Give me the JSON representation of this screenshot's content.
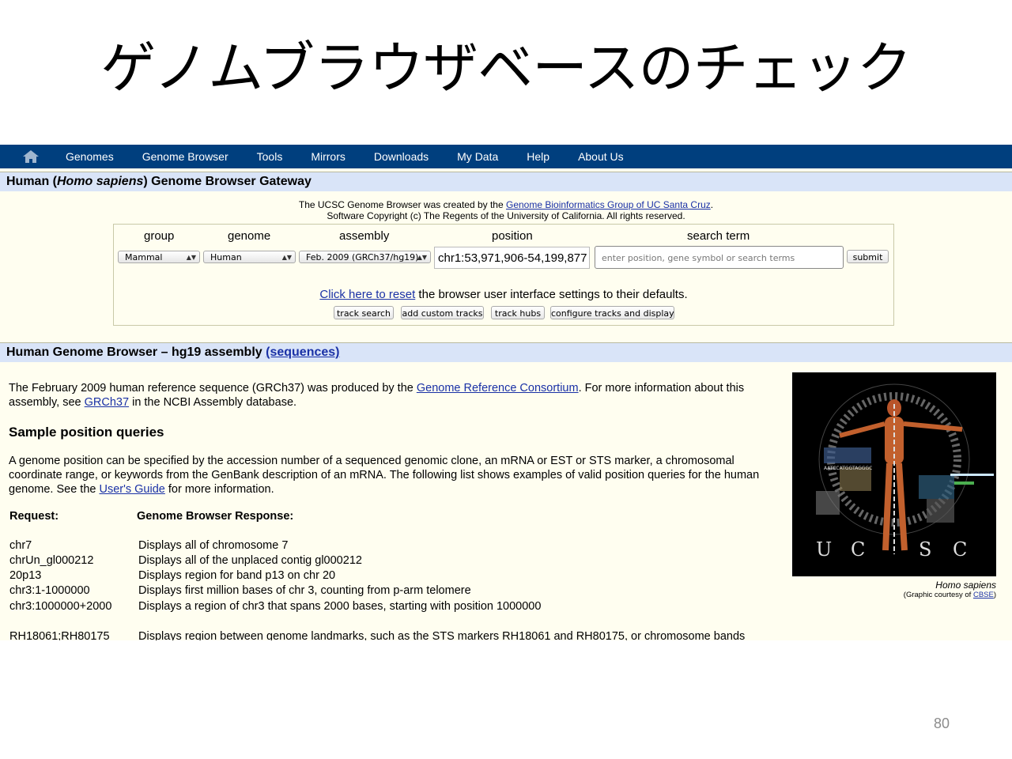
{
  "slide": {
    "title": "ゲノムブラウザベースのチェック",
    "page_number": "80"
  },
  "nav": {
    "home_icon": "home-icon",
    "items": [
      "Genomes",
      "Genome Browser",
      "Tools",
      "Mirrors",
      "Downloads",
      "My Data",
      "Help",
      "About Us"
    ]
  },
  "gateway": {
    "title_prefix": "Human (",
    "title_species": "Homo sapiens",
    "title_suffix": ") Genome Browser Gateway",
    "credit_text1": "The UCSC Genome Browser was created by the ",
    "credit_link": "Genome Bioinformatics Group of UC Santa Cruz",
    "credit_text1_end": ".",
    "credit_text2": "Software Copyright (c) The Regents of the University of California. All rights reserved.",
    "labels": {
      "group": "group",
      "genome": "genome",
      "assembly": "assembly",
      "position": "position",
      "search_term": "search term"
    },
    "group_value": "Mammal",
    "genome_value": "Human",
    "assembly_value": "Feb. 2009 (GRCh37/hg19)",
    "position_value": "chr1:53,971,906-54,199,877",
    "search_placeholder": "enter position, gene symbol or search terms",
    "submit_label": "submit",
    "reset_link": "Click here to reset",
    "reset_text": " the browser user interface settings to their defaults.",
    "buttons": {
      "track_search": "track search",
      "add_custom_tracks": "add custom tracks",
      "track_hubs": "track hubs",
      "configure": "configure tracks and display"
    }
  },
  "browser": {
    "title": "Human Genome Browser – hg19 assembly ",
    "sequences_link": "(sequences)",
    "intro_1": "The February 2009 human reference sequence (GRCh37) was produced by the ",
    "intro_link1": "Genome Reference Consortium",
    "intro_2": ". For more information about this assembly, see ",
    "intro_link2": "GRCh37",
    "intro_3": " in the NCBI Assembly database.",
    "sample_heading": "Sample position queries",
    "para_1": "A genome position can be specified by the accession number of a sequenced genomic clone, an mRNA or EST or STS marker, a chromosomal coordinate range, or keywords from the GenBank description of an mRNA. The following list shows examples of valid position queries for the human genome. See the ",
    "para_link": "User's Guide",
    "para_2": " for more information.",
    "col_request": "Request:",
    "col_response": "Genome Browser Response:",
    "queries": [
      {
        "request": "chr7",
        "response": "Displays all of chromosome 7"
      },
      {
        "request": "chrUn_gl000212",
        "response": "Displays all of the unplaced contig gl000212"
      },
      {
        "request": "20p13",
        "response": "Displays region for band p13 on chr 20"
      },
      {
        "request": "chr3:1-1000000",
        "response": "Displays first million bases of chr 3, counting from p-arm telomere"
      },
      {
        "request": "chr3:1000000+2000",
        "response": "Displays a region of chr3 that spans 2000 bases, starting with position 1000000"
      },
      {
        "request": "RH18061;RH80175",
        "response": "Displays region between genome landmarks, such as the STS markers RH18061 and RH80175, or chromosome bands"
      }
    ],
    "image_letters": [
      "U",
      "C",
      "S",
      "C"
    ],
    "image_text": "AATCCATGGTAGGGC",
    "caption_species": "Homo sapiens",
    "caption_credit_prefix": "(Graphic courtesy of ",
    "caption_credit_link": "CBSE",
    "caption_credit_suffix": ")"
  },
  "colors": {
    "navbar": "#003f7e",
    "header_bg": "#d9e4f8",
    "page_bg": "#fffef0",
    "link": "#1a31a6"
  }
}
